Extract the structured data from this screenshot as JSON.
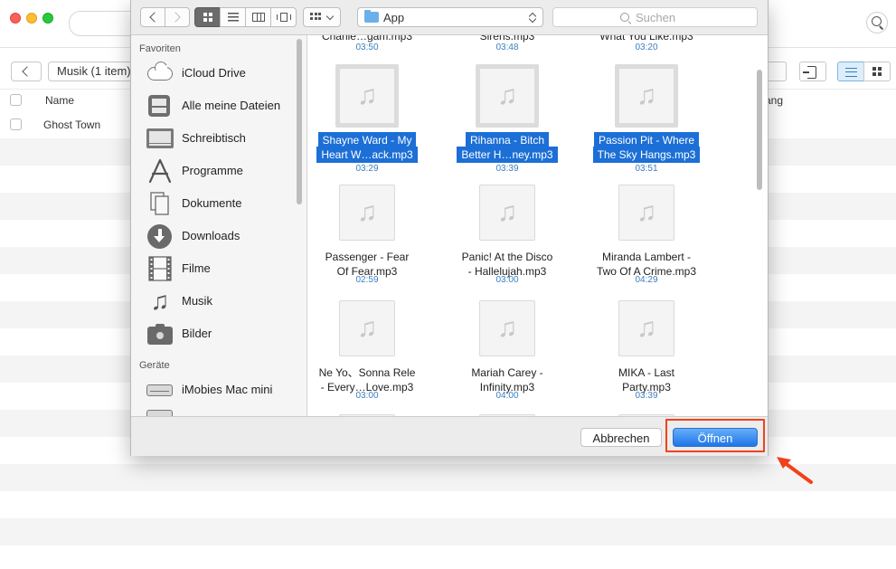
{
  "app": {
    "breadcrumb_label": "Musik (1 item)",
    "table_headers": {
      "name": "Name",
      "right_partial": "ang"
    },
    "rows": [
      {
        "name": "Ghost Town"
      }
    ]
  },
  "dialog": {
    "path_label": "App",
    "search_placeholder": "Suchen",
    "sidebar": {
      "favorites_header": "Favoriten",
      "favorites": [
        {
          "label": "iCloud Drive",
          "icon": "cloud-icon"
        },
        {
          "label": "Alle meine Dateien",
          "icon": "all-files-icon"
        },
        {
          "label": "Schreibtisch",
          "icon": "desktop-icon"
        },
        {
          "label": "Programme",
          "icon": "applications-icon"
        },
        {
          "label": "Dokumente",
          "icon": "documents-icon"
        },
        {
          "label": "Downloads",
          "icon": "downloads-icon"
        },
        {
          "label": "Filme",
          "icon": "movies-icon"
        },
        {
          "label": "Musik",
          "icon": "music-icon"
        },
        {
          "label": "Bilder",
          "icon": "pictures-icon"
        }
      ],
      "devices_header": "Geräte",
      "devices": [
        {
          "label": "iMobies Mac mini",
          "icon": "mac-mini-icon"
        }
      ]
    },
    "top_partial": [
      {
        "name": "Charlie…gam.mp3",
        "duration": "03:50"
      },
      {
        "name": "Sirens.mp3",
        "duration": "03:48"
      },
      {
        "name": "What You Like.mp3",
        "duration": "03:20"
      }
    ],
    "files": [
      {
        "line1": "Shayne Ward - My",
        "line2": "Heart W…ack.mp3",
        "duration": "03:29",
        "selected": true
      },
      {
        "line1": "Rihanna - Bitch",
        "line2": "Better H…ney.mp3",
        "duration": "03:39",
        "selected": true
      },
      {
        "line1": "Passion Pit - Where",
        "line2": "The Sky Hangs.mp3",
        "duration": "03:51",
        "selected": true
      },
      {
        "line1": "Passenger - Fear",
        "line2": "Of Fear.mp3",
        "duration": "02:59",
        "selected": false
      },
      {
        "line1": "Panic! At the Disco",
        "line2": "- Hallelujah.mp3",
        "duration": "03:00",
        "selected": false
      },
      {
        "line1": "Miranda Lambert -",
        "line2": "Two Of A Crime.mp3",
        "duration": "04:29",
        "selected": false
      },
      {
        "line1": "Ne Yo、Sonna Rele",
        "line2": "- Every…Love.mp3",
        "duration": "03:00",
        "selected": false
      },
      {
        "line1": "Mariah Carey -",
        "line2": "Infinity.mp3",
        "duration": "04:00",
        "selected": false
      },
      {
        "line1": "MIKA - Last",
        "line2": "Party.mp3",
        "duration": "03:39",
        "selected": false
      }
    ],
    "buttons": {
      "cancel": "Abbrechen",
      "open": "Öffnen"
    }
  },
  "colors": {
    "accent": "#1c6fd6",
    "highlight": "#f0421b",
    "duration_text": "#3a7ec1"
  }
}
